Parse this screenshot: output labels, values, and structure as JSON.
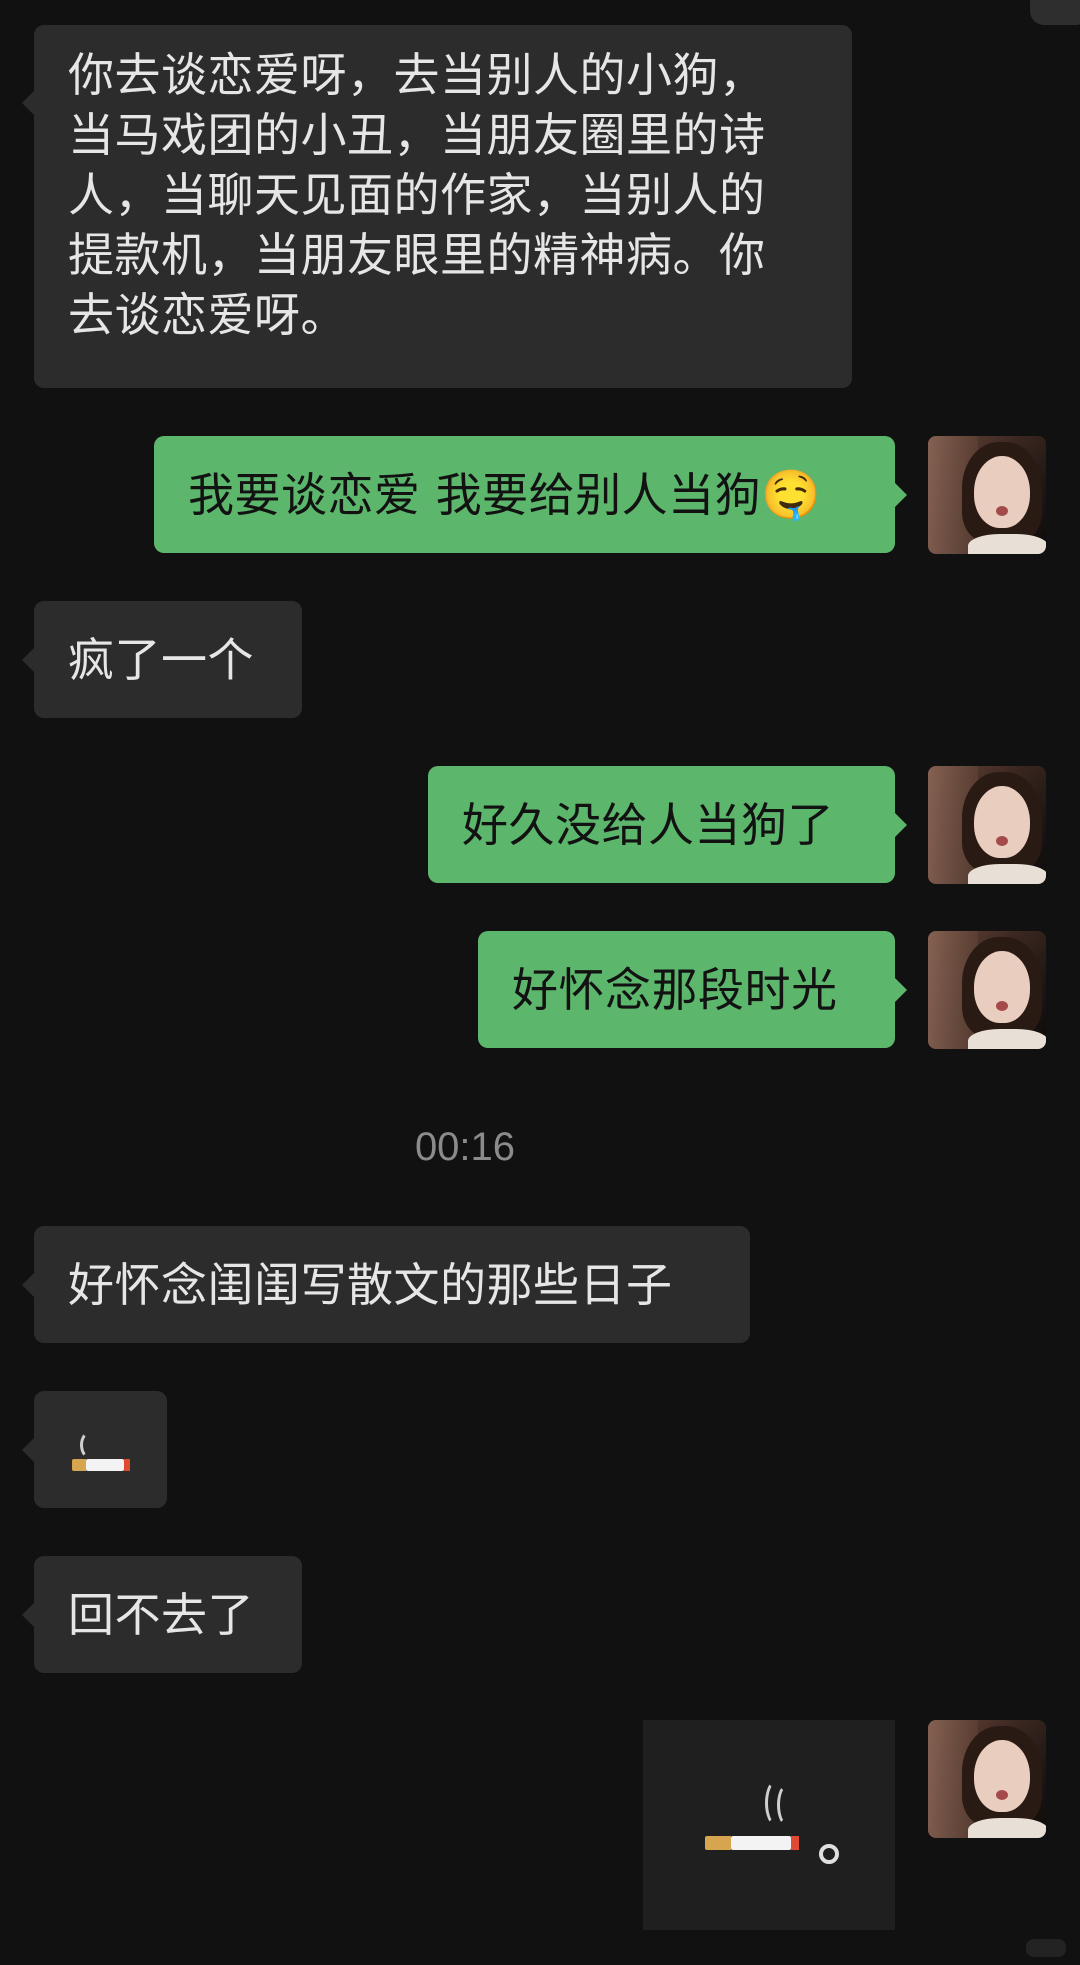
{
  "messages": [
    {
      "side": "left",
      "text": "你去谈恋爱呀，去当别人的小狗，当马戏团的小丑，当朋友圈里的诗人，当聊天见面的作家，当别人的提款机，当朋友眼里的精神病。你去谈恋爱呀。",
      "lines": [
        "你去谈恋爱呀，去当别人的小狗，",
        "当马戏团的小丑，当朋友圈里的诗",
        "人，当聊天见面的作家，当别人的",
        "提款机，当朋友眼里的精神病。你",
        "去谈恋爱呀。"
      ]
    },
    {
      "side": "right",
      "text": "我要谈恋爱 我要给别人当狗",
      "emoji": "🤤"
    },
    {
      "side": "left",
      "text": "疯了一个"
    },
    {
      "side": "right",
      "text": "好久没给人当狗了"
    },
    {
      "side": "right",
      "text": "好怀念那段时光"
    },
    {
      "side": "left",
      "text": "好怀念闺闺写散文的那些日子"
    },
    {
      "side": "left",
      "sticker": "cigarette-emoji"
    },
    {
      "side": "left",
      "text": "回不去了"
    },
    {
      "side": "right",
      "sticker": "cigarette-sticker"
    }
  ],
  "timestamp": "00:16",
  "colors": {
    "background": "#111111",
    "left_bubble": "#2c2c2c",
    "right_bubble": "#5cb66c",
    "left_text": "#e6e6e6",
    "right_text": "#121212",
    "timestamp": "#8b8b8b"
  },
  "icons": {
    "avatar": "user-avatar-photo",
    "emoji": "drooling-heart-eyes-emoji",
    "sticker": "cigarette-icon"
  }
}
